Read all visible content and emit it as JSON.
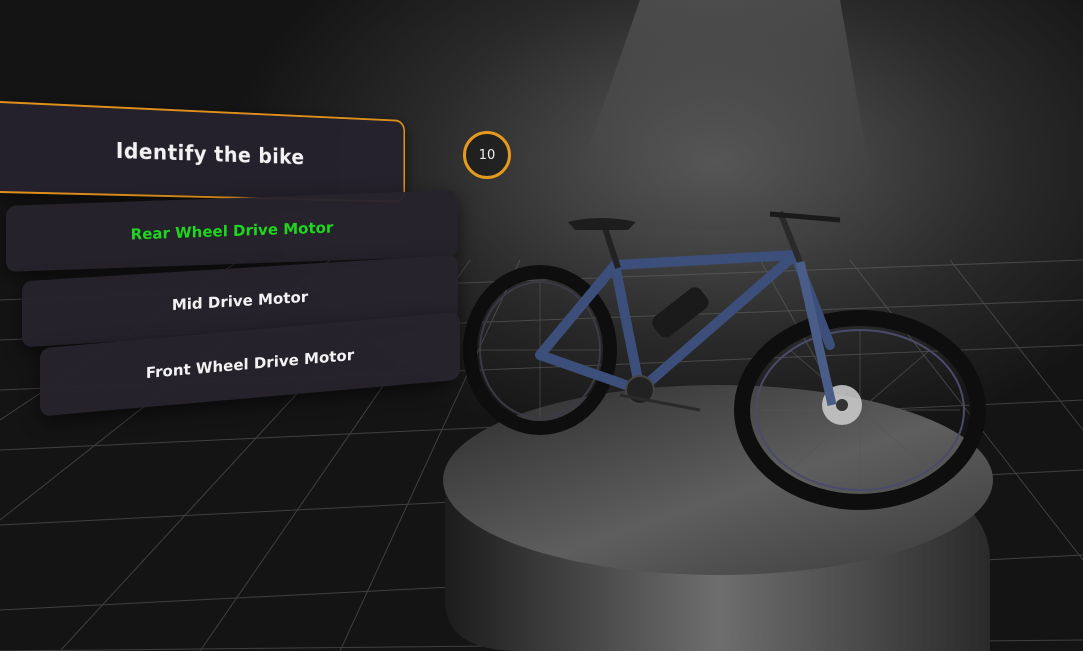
{
  "question": {
    "text": "Identify the bike"
  },
  "timer": {
    "value": "10"
  },
  "options": [
    {
      "label": "Rear Wheel Drive Motor",
      "state": "correct"
    },
    {
      "label": "Mid Drive Motor",
      "state": "normal"
    },
    {
      "label": "Front Wheel Drive Motor",
      "state": "normal"
    }
  ],
  "colors": {
    "accent": "#e0901a",
    "correct": "#1fd51f",
    "panel": "#26232d",
    "bike_frame": "#3c4f7a",
    "background": "#141414"
  }
}
